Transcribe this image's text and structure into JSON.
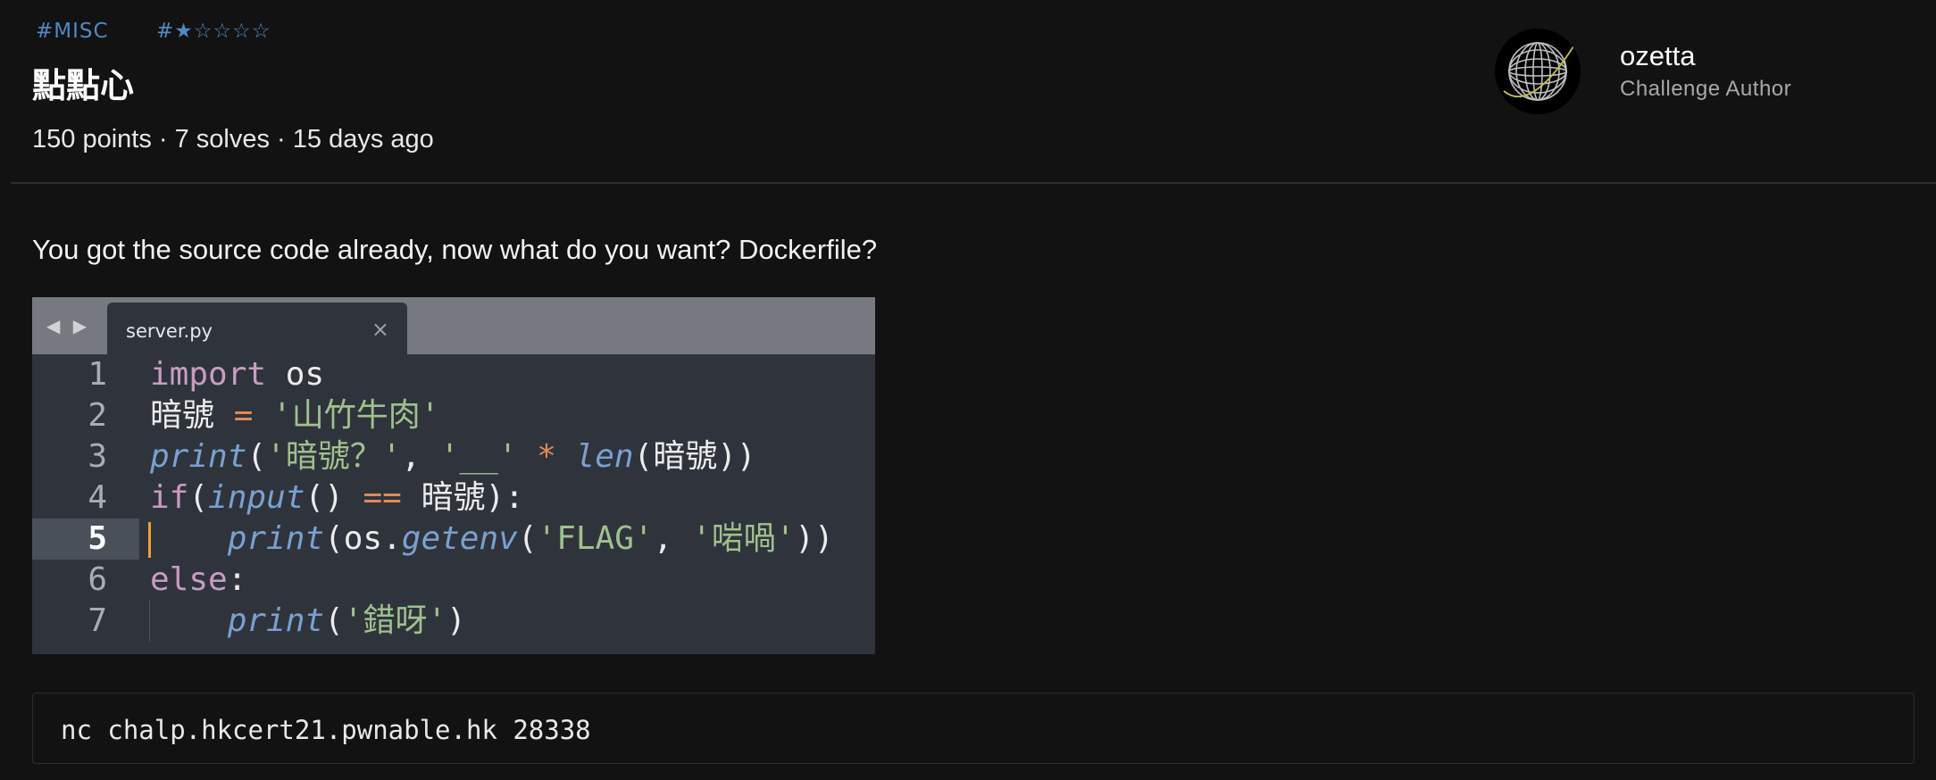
{
  "tags": {
    "category": "#MISC",
    "difficulty": "#★☆☆☆☆"
  },
  "challenge": {
    "title": "點點心",
    "meta": "150 points · 7 solves · 15 days ago",
    "description": "You got the source code already, now what do you want? Dockerfile?",
    "command": "nc chalp.hkcert21.pwnable.hk 28338"
  },
  "author": {
    "name": "ozetta",
    "role": "Challenge Author"
  },
  "code_image": {
    "tab_name": "server.py",
    "tab_close": "×",
    "nav": "◀ ▶",
    "active_line": 5,
    "line_numbers": [
      "1",
      "2",
      "3",
      "4",
      "5",
      "6",
      "7"
    ],
    "lines": [
      [
        {
          "t": "kw",
          "v": "import"
        },
        {
          "t": "plain",
          "v": " os"
        }
      ],
      [
        {
          "t": "plain",
          "v": "暗號 "
        },
        {
          "t": "op",
          "v": "="
        },
        {
          "t": "str",
          "v": " '山竹牛肉'"
        }
      ],
      [
        {
          "t": "fn",
          "v": "print"
        },
        {
          "t": "plain",
          "v": "("
        },
        {
          "t": "str",
          "v": "'暗號？'"
        },
        {
          "t": "plain",
          "v": ", "
        },
        {
          "t": "str",
          "v": "'__'"
        },
        {
          "t": "op",
          "v": " * "
        },
        {
          "t": "fn",
          "v": "len"
        },
        {
          "t": "plain",
          "v": "(暗號))"
        }
      ],
      [
        {
          "t": "kw",
          "v": "if"
        },
        {
          "t": "plain",
          "v": "("
        },
        {
          "t": "fn",
          "v": "input"
        },
        {
          "t": "plain",
          "v": "() "
        },
        {
          "t": "op",
          "v": "=="
        },
        {
          "t": "plain",
          "v": " 暗號):"
        }
      ],
      [
        {
          "t": "plain",
          "v": "    "
        },
        {
          "t": "fn",
          "v": "print"
        },
        {
          "t": "plain",
          "v": "(os."
        },
        {
          "t": "fn",
          "v": "getenv"
        },
        {
          "t": "plain",
          "v": "("
        },
        {
          "t": "str",
          "v": "'FLAG'"
        },
        {
          "t": "plain",
          "v": ", "
        },
        {
          "t": "str",
          "v": "'啱喎'"
        },
        {
          "t": "plain",
          "v": "))"
        }
      ],
      [
        {
          "t": "kw",
          "v": "else"
        },
        {
          "t": "plain",
          "v": ":"
        }
      ],
      [
        {
          "t": "plain",
          "v": "    "
        },
        {
          "t": "fn",
          "v": "print"
        },
        {
          "t": "plain",
          "v": "("
        },
        {
          "t": "str",
          "v": "'錯呀'"
        },
        {
          "t": "plain",
          "v": ")"
        }
      ]
    ]
  },
  "colors": {
    "accent": "#4f88c6",
    "background": "#121212",
    "editor_bg": "#2f343c",
    "caret": "#f0a030"
  }
}
